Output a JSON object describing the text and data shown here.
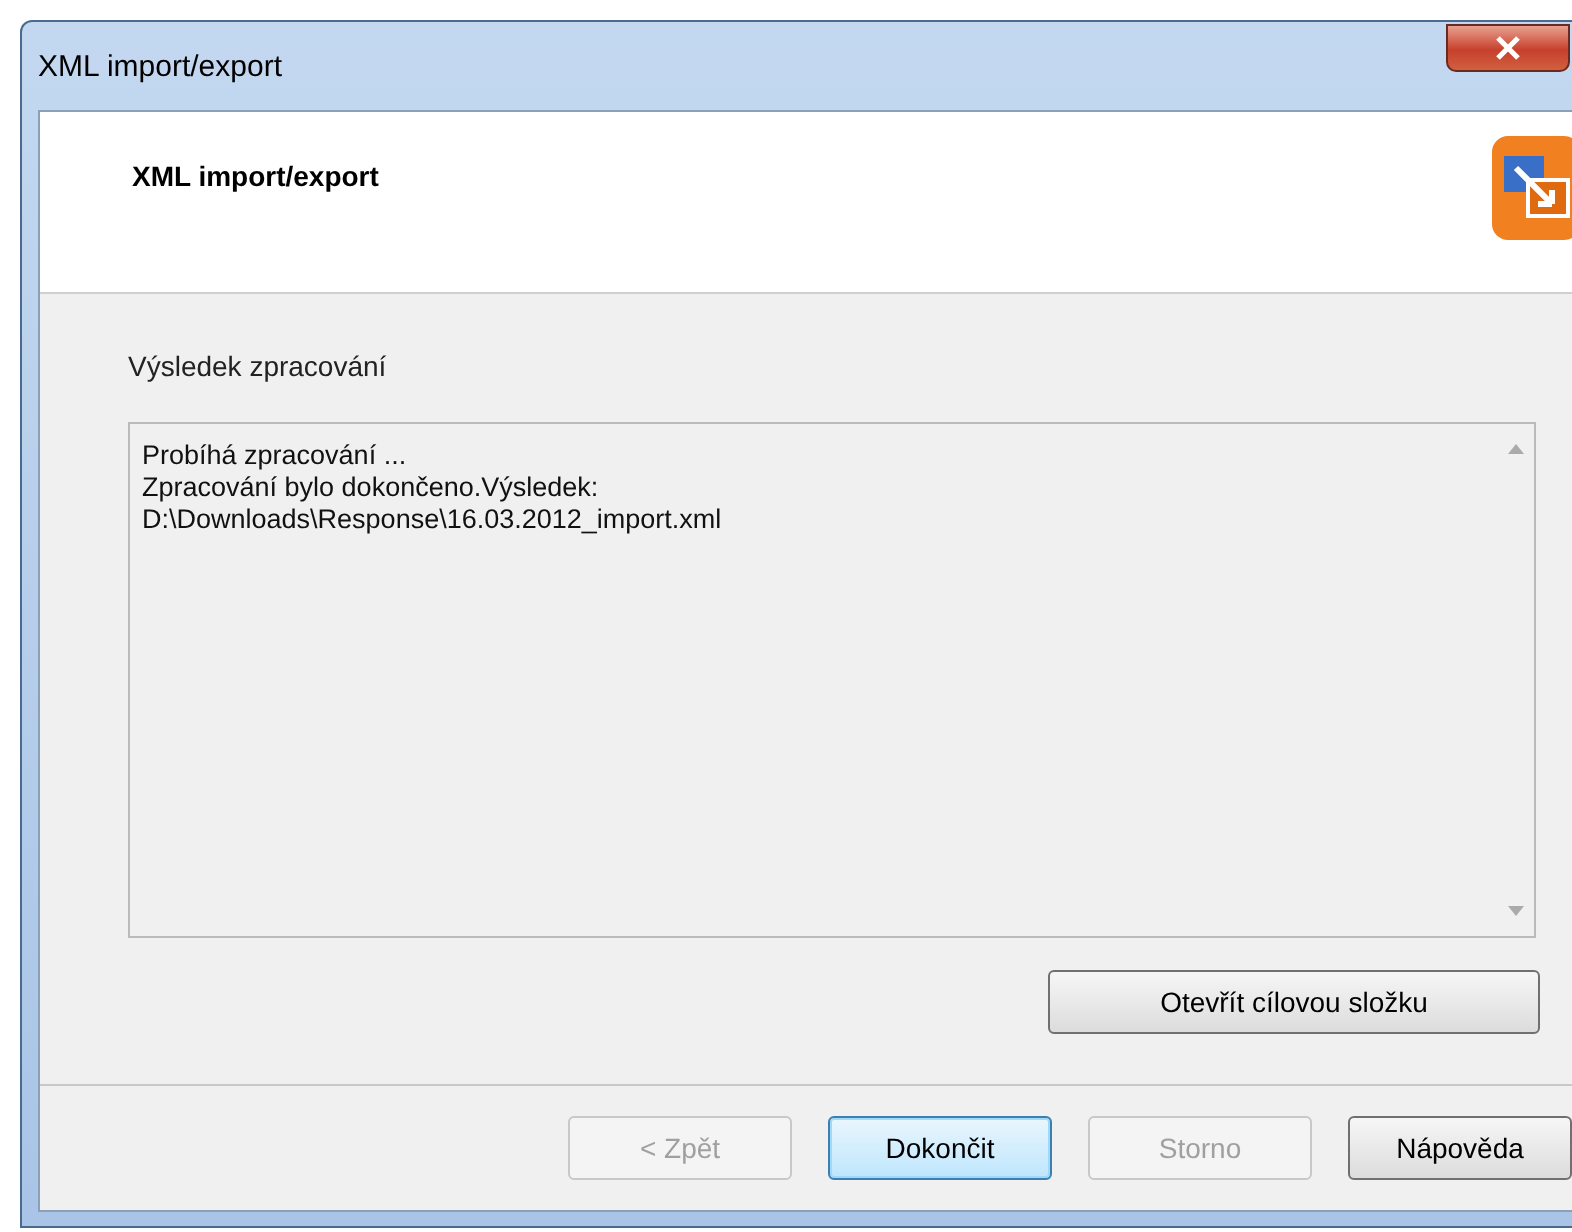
{
  "window": {
    "title": "XML import/export"
  },
  "header": {
    "title": "XML import/export"
  },
  "section_label": "Výsledek zpracování",
  "log_lines": [
    "Probíhá zpracování ...",
    "Zpracování bylo dokončeno.Výsledek:",
    "D:\\Downloads\\Response\\16.03.2012_import.xml"
  ],
  "open_folder_button": "Otevřít cílovou složku",
  "buttons": [
    {
      "label": "< Zpět",
      "disabled": true,
      "default": false
    },
    {
      "label": "Dokončit",
      "disabled": false,
      "default": true
    },
    {
      "label": "Storno",
      "disabled": true,
      "default": false
    },
    {
      "label": "Nápověda",
      "disabled": false,
      "default": false
    }
  ]
}
